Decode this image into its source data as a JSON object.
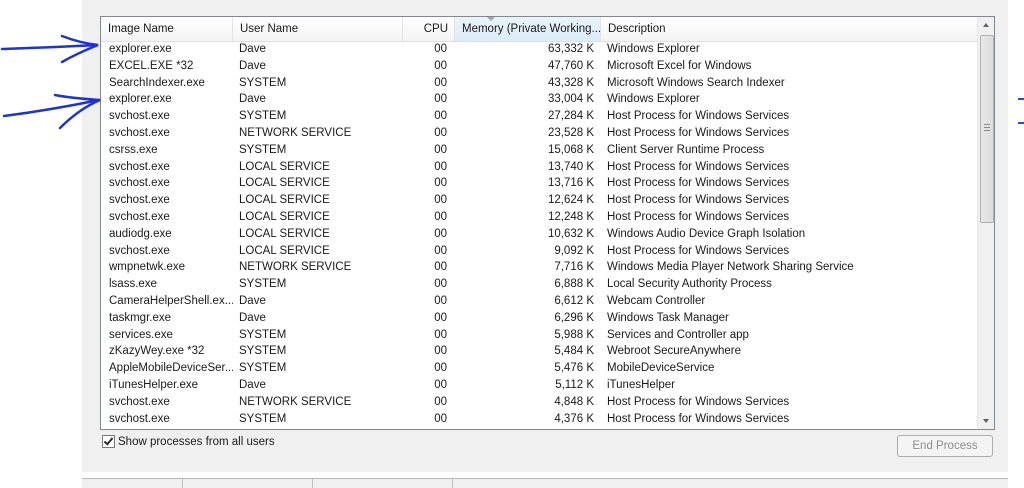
{
  "columns": {
    "image_name": "Image Name",
    "user_name": "User Name",
    "cpu": "CPU",
    "memory": "Memory (Private Working...",
    "description": "Description"
  },
  "processes": [
    {
      "name": "explorer.exe",
      "user": "Dave",
      "cpu": "00",
      "memory": "63,332 K",
      "description": "Windows Explorer"
    },
    {
      "name": "EXCEL.EXE *32",
      "user": "Dave",
      "cpu": "00",
      "memory": "47,760 K",
      "description": "Microsoft Excel for Windows"
    },
    {
      "name": "SearchIndexer.exe",
      "user": "SYSTEM",
      "cpu": "00",
      "memory": "43,328 K",
      "description": "Microsoft Windows Search Indexer"
    },
    {
      "name": "explorer.exe",
      "user": "Dave",
      "cpu": "00",
      "memory": "33,004 K",
      "description": "Windows Explorer"
    },
    {
      "name": "svchost.exe",
      "user": "SYSTEM",
      "cpu": "00",
      "memory": "27,284 K",
      "description": "Host Process for Windows Services"
    },
    {
      "name": "svchost.exe",
      "user": "NETWORK SERVICE",
      "cpu": "00",
      "memory": "23,528 K",
      "description": "Host Process for Windows Services"
    },
    {
      "name": "csrss.exe",
      "user": "SYSTEM",
      "cpu": "00",
      "memory": "15,068 K",
      "description": "Client Server Runtime Process"
    },
    {
      "name": "svchost.exe",
      "user": "LOCAL SERVICE",
      "cpu": "00",
      "memory": "13,740 K",
      "description": "Host Process for Windows Services"
    },
    {
      "name": "svchost.exe",
      "user": "LOCAL SERVICE",
      "cpu": "00",
      "memory": "13,716 K",
      "description": "Host Process for Windows Services"
    },
    {
      "name": "svchost.exe",
      "user": "LOCAL SERVICE",
      "cpu": "00",
      "memory": "12,624 K",
      "description": "Host Process for Windows Services"
    },
    {
      "name": "svchost.exe",
      "user": "LOCAL SERVICE",
      "cpu": "00",
      "memory": "12,248 K",
      "description": "Host Process for Windows Services"
    },
    {
      "name": "audiodg.exe",
      "user": "LOCAL SERVICE",
      "cpu": "00",
      "memory": "10,632 K",
      "description": "Windows Audio Device Graph Isolation"
    },
    {
      "name": "svchost.exe",
      "user": "LOCAL SERVICE",
      "cpu": "00",
      "memory": "9,092 K",
      "description": "Host Process for Windows Services"
    },
    {
      "name": "wmpnetwk.exe",
      "user": "NETWORK SERVICE",
      "cpu": "00",
      "memory": "7,716 K",
      "description": "Windows Media Player Network Sharing Service"
    },
    {
      "name": "lsass.exe",
      "user": "SYSTEM",
      "cpu": "00",
      "memory": "6,888 K",
      "description": "Local Security Authority Process"
    },
    {
      "name": "CameraHelperShell.ex...",
      "user": "Dave",
      "cpu": "00",
      "memory": "6,612 K",
      "description": "Webcam Controller"
    },
    {
      "name": "taskmgr.exe",
      "user": "Dave",
      "cpu": "00",
      "memory": "6,296 K",
      "description": "Windows Task Manager"
    },
    {
      "name": "services.exe",
      "user": "SYSTEM",
      "cpu": "00",
      "memory": "5,988 K",
      "description": "Services and Controller app"
    },
    {
      "name": "zKazyWey.exe *32",
      "user": "SYSTEM",
      "cpu": "00",
      "memory": "5,484 K",
      "description": "Webroot SecureAnywhere"
    },
    {
      "name": "AppleMobileDeviceSer...",
      "user": "SYSTEM",
      "cpu": "00",
      "memory": "5,476 K",
      "description": "MobileDeviceService"
    },
    {
      "name": "iTunesHelper.exe",
      "user": "Dave",
      "cpu": "00",
      "memory": "5,112 K",
      "description": "iTunesHelper"
    },
    {
      "name": "svchost.exe",
      "user": "NETWORK SERVICE",
      "cpu": "00",
      "memory": "4,848 K",
      "description": "Host Process for Windows Services"
    },
    {
      "name": "svchost.exe",
      "user": "SYSTEM",
      "cpu": "00",
      "memory": "4,376 K",
      "description": "Host Process for Windows Services"
    }
  ],
  "show_all_users": {
    "label": "Show processes from all users",
    "checked": true
  },
  "end_process_label": "End Process",
  "colors": {
    "annotation_ink": "#1f34c8",
    "sorted_header": "#e9f4fc",
    "disabled_text": "#8c8c8c"
  }
}
